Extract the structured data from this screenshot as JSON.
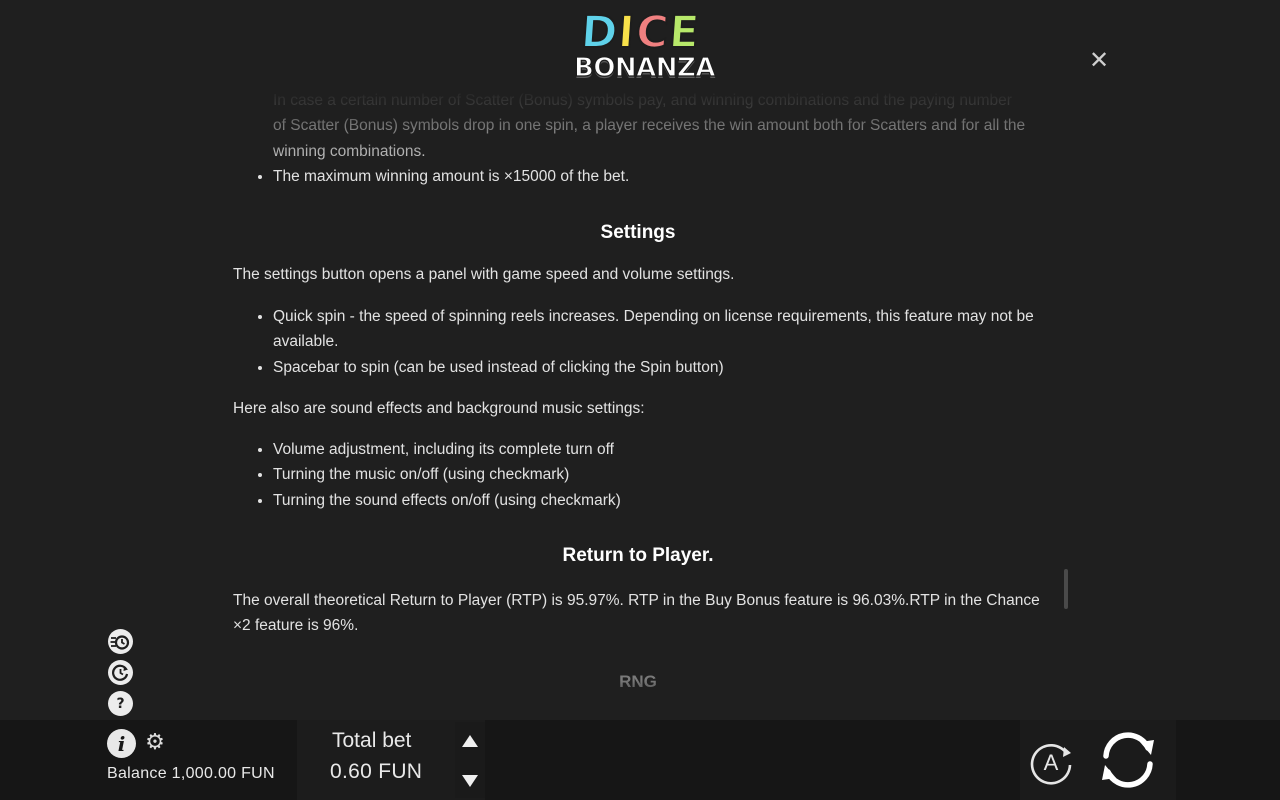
{
  "logo": {
    "top_letters": [
      "D",
      "I",
      "C",
      "E"
    ],
    "top_colors": [
      "#5fd2ea",
      "#f7e04a",
      "#f08080",
      "#b7e86a"
    ],
    "bottom": "BONANZA"
  },
  "close": {
    "glyph": "✕"
  },
  "content": {
    "partial_line": "In case a certain number of Scatter (Bonus) symbols pay, and winning combinations and the paying number",
    "bullets_top": [
      "of Scatter (Bonus) symbols drop in one spin, a player receives the win amount both for Scatters and for all the winning combinations.",
      "The maximum winning amount is ×15000 of the bet."
    ],
    "settings": {
      "title": "Settings",
      "intro": "The settings button opens a panel with game speed and volume settings.",
      "bullets": [
        "Quick spin - the speed of spinning reels increases. Depending on license requirements, this feature may not be available.",
        "Spacebar to spin (can be used instead of clicking the Spin button)"
      ],
      "sound_intro": "Here also are sound effects and background music settings:",
      "sound_bullets": [
        "Volume adjustment, including its complete turn off",
        "Turning the music on/off (using checkmark)",
        "Turning the sound effects on/off (using checkmark)"
      ]
    },
    "rtp": {
      "title": "Return to Player.",
      "text": "The overall theoretical Return to Player (RTP) is 95.97%. RTP in the Buy Bonus feature is 96.03%.RTP in the Chance ×2 feature is 96%."
    },
    "rng_title": "RNG"
  },
  "side_icons": {
    "turbo": "⚡",
    "autoplay": "↻",
    "help": "?"
  },
  "bottom_bar": {
    "info": "i",
    "gear": "⚙",
    "balance": "Balance 1,000.00 FUN",
    "bet_label": "Total bet",
    "bet_value": "0.60 FUN",
    "autoplay_letter": "A"
  }
}
